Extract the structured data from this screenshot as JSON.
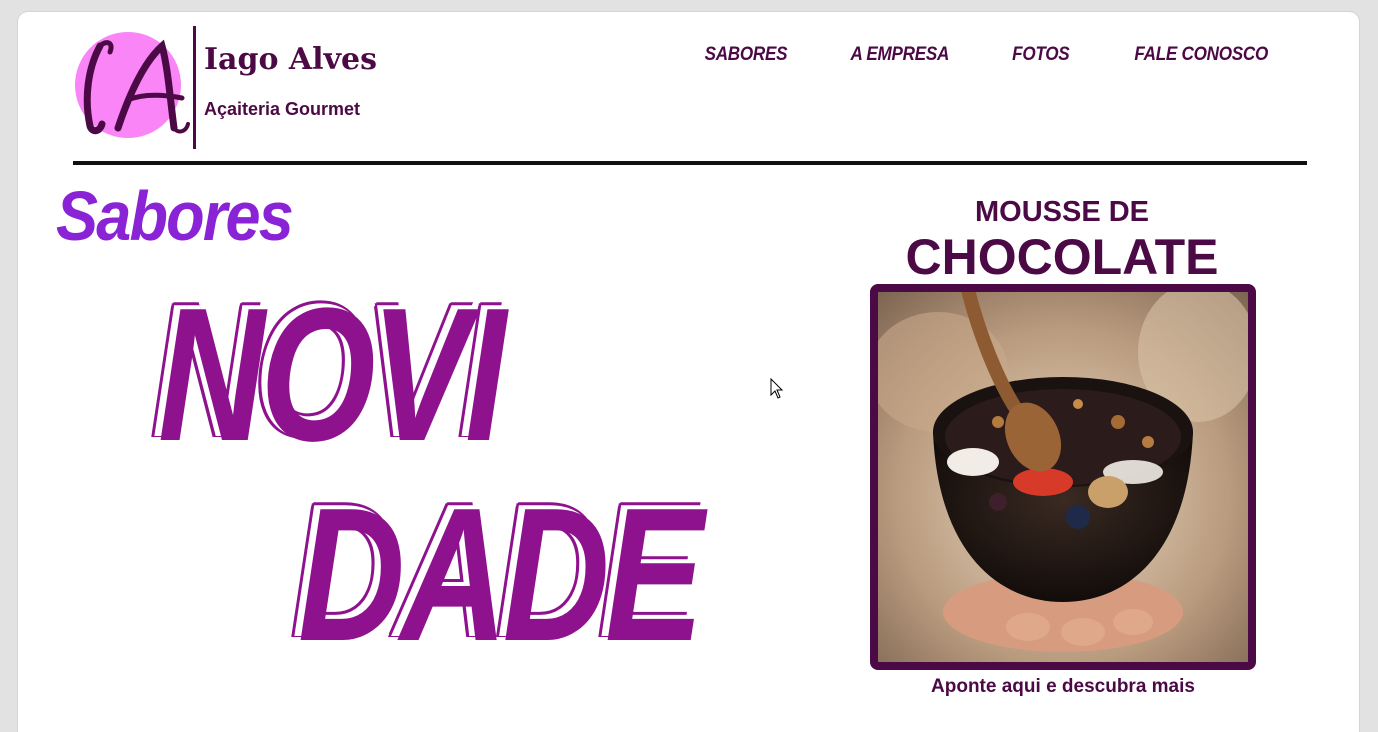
{
  "brand": {
    "monogram": "IA",
    "name": "Iago Alves",
    "tagline": "Açaiteria Gourmet"
  },
  "nav": {
    "items": [
      "SABORES",
      "A EMPRESA",
      "FOTOS",
      "FALE CONOSCO"
    ]
  },
  "section": {
    "title": "Sabores",
    "headline_line1": "NOVI",
    "headline_line2": "DADE"
  },
  "product": {
    "line1": "MOUSSE DE",
    "line2": "CHOCOLATE",
    "caption": "Aponte aqui e descubra mais"
  },
  "colors": {
    "brand_dark": "#4b0a45",
    "logo_circle": "#f985f7",
    "section_title": "#8a23d6",
    "headline": "#8e128e"
  },
  "icons": {
    "cursor": "arrow-pointer-icon"
  }
}
